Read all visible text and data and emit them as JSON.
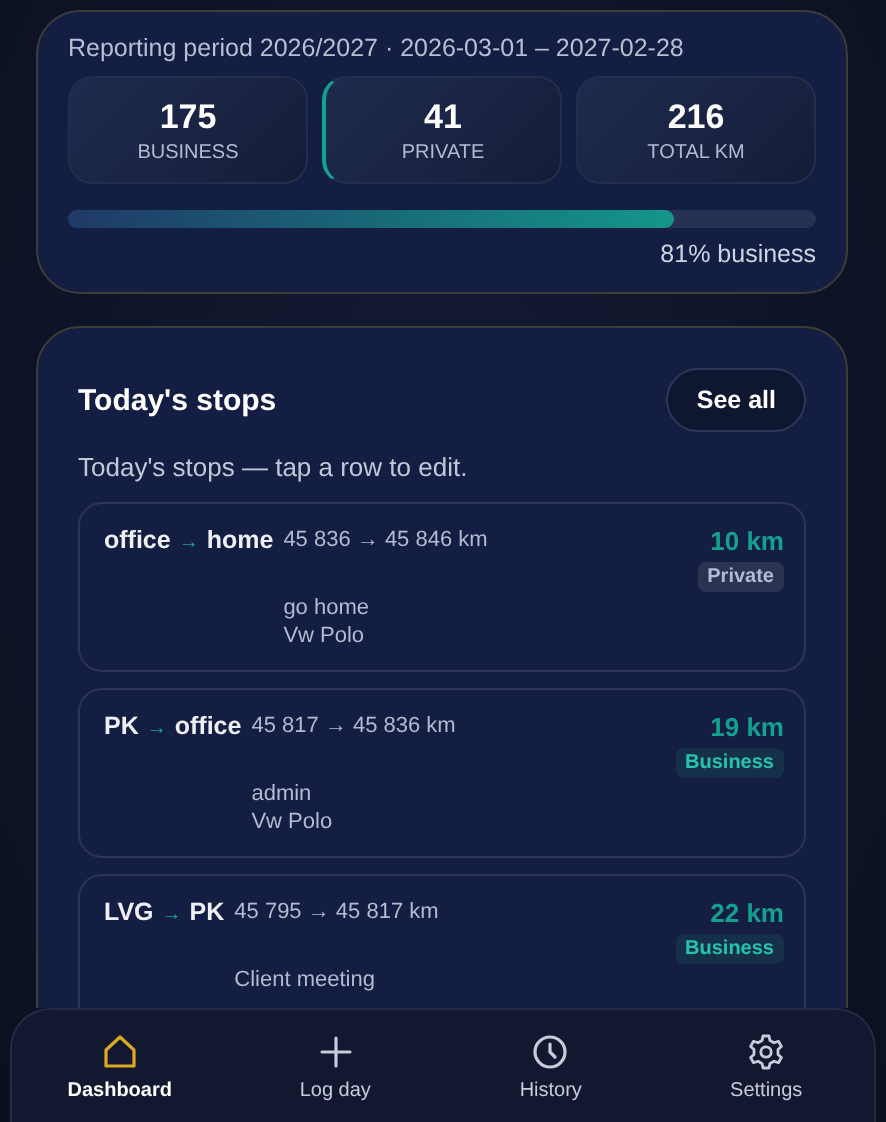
{
  "period": "Reporting period 2026/2027 · 2026-03-01 – 2027-02-28",
  "stats": [
    {
      "value": "175",
      "label": "BUSINESS",
      "selected": false
    },
    {
      "value": "41",
      "label": "PRIVATE",
      "selected": true
    },
    {
      "value": "216",
      "label": "TOTAL KM",
      "selected": false
    }
  ],
  "business_share": {
    "level": 0.81,
    "reading": "81% business"
  },
  "stops_card": {
    "title": "Today's stops",
    "see_all": "See all",
    "hint": "Today's stops — tap a row to edit.",
    "stops": [
      {
        "from": "office",
        "arrow": "→",
        "to": "home",
        "odometer": "45 836 → 45 846 km",
        "distance": "10 km",
        "category": "Private",
        "kind": "private",
        "note": "go home",
        "vehicle": "Vw Polo"
      },
      {
        "from": "PK",
        "arrow": "→",
        "to": "office",
        "odometer": "45 817 → 45 836 km",
        "distance": "19 km",
        "category": "Business",
        "kind": "business",
        "note": "admin",
        "vehicle": "Vw Polo"
      },
      {
        "from": "LVG",
        "arrow": "→",
        "to": "PK",
        "odometer": "45 795 → 45 817 km",
        "distance": "22 km",
        "category": "Business",
        "kind": "business",
        "note": "Client meeting"
      }
    ]
  },
  "nav": [
    {
      "label": "Dashboard",
      "kind": "home",
      "selected": true
    },
    {
      "label": "Log day",
      "kind": "add",
      "selected": false
    },
    {
      "label": "History",
      "kind": "history",
      "selected": false
    },
    {
      "label": "Settings",
      "kind": "settings",
      "selected": false
    }
  ]
}
